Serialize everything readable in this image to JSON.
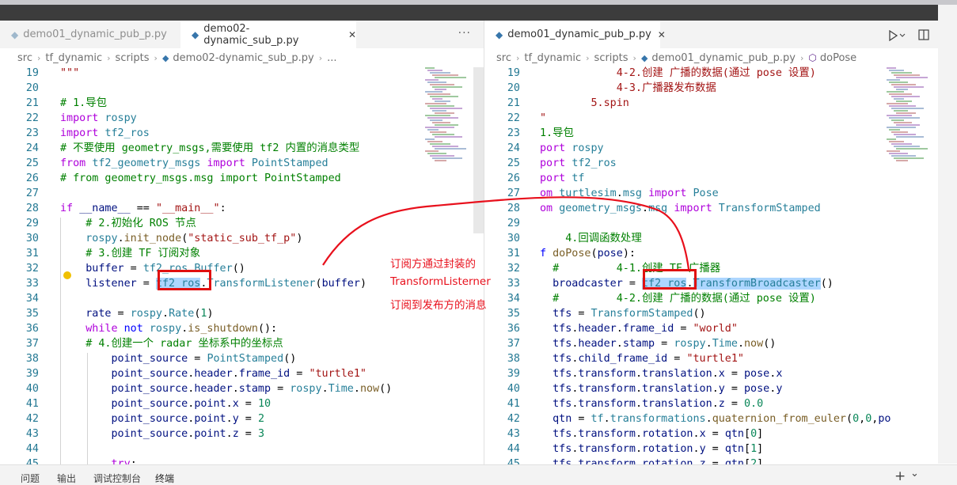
{
  "left_editor": {
    "tabs": [
      {
        "label": "demo01_dynamic_pub_p.py",
        "active": false
      },
      {
        "label": "demo02-dynamic_sub_p.py",
        "active": true
      }
    ],
    "breadcrumb": [
      "src",
      "tf_dynamic",
      "scripts",
      "demo02-dynamic_sub_p.py",
      "..."
    ],
    "lines": [
      {
        "n": "19",
        "html": "<span class='s'>\"\"\"</span>"
      },
      {
        "n": "20",
        "html": ""
      },
      {
        "n": "21",
        "html": "<span class='c'># 1.导包</span>"
      },
      {
        "n": "22",
        "html": "<span class='k'>import</span> <span class='t'>rospy</span>"
      },
      {
        "n": "23",
        "html": "<span class='k'>import</span> <span class='t'>tf2_ros</span>"
      },
      {
        "n": "24",
        "html": "<span class='c'># 不要使用 geometry_msgs,需要使用 tf2 内置的消息类型</span>"
      },
      {
        "n": "25",
        "html": "<span class='k'>from</span> <span class='t'>tf2_geometry_msgs</span> <span class='k'>import</span> <span class='t'>PointStamped</span>"
      },
      {
        "n": "26",
        "html": "<span class='c'># from geometry_msgs.msg import PointStamped</span>"
      },
      {
        "n": "27",
        "html": ""
      },
      {
        "n": "28",
        "html": "<span class='k'>if</span> <span class='v'>__name__</span> == <span class='s'>\"__main__\"</span>:"
      },
      {
        "n": "29",
        "html": "    <span class='c'># 2.初始化 ROS 节点</span>"
      },
      {
        "n": "30",
        "html": "    <span class='t'>rospy</span>.<span class='f'>init_node</span>(<span class='s'>\"static_sub_tf_p\"</span>)"
      },
      {
        "n": "31",
        "html": "    <span class='c'># 3.创建 TF 订阅对象</span>"
      },
      {
        "n": "32",
        "html": "    <span class='v'>buffer</span> = <span class='t'>tf2_ros</span>.<span class='t'>Buffer</span>()"
      },
      {
        "n": "33",
        "html": "    <span class='v'>listener</span> = <span class='t hl'>tf2_ros</span>.<span class='t'>TransformListener</span>(<span class='v'>buffer</span>)"
      },
      {
        "n": "34",
        "html": ""
      },
      {
        "n": "35",
        "html": "    <span class='v'>rate</span> = <span class='t'>rospy</span>.<span class='t'>Rate</span>(<span class='n'>1</span>)"
      },
      {
        "n": "36",
        "html": "    <span class='k'>while</span> <span class='b'>not</span> <span class='t'>rospy</span>.<span class='f'>is_shutdown</span>():"
      },
      {
        "n": "37",
        "html": "    <span class='c'># 4.创建一个 radar 坐标系中的坐标点</span>"
      },
      {
        "n": "38",
        "html": "        <span class='v'>point_source</span> = <span class='t'>PointStamped</span>()"
      },
      {
        "n": "39",
        "html": "        <span class='v'>point_source</span>.<span class='v'>header</span>.<span class='v'>frame_id</span> = <span class='s'>\"turtle1\"</span>"
      },
      {
        "n": "40",
        "html": "        <span class='v'>point_source</span>.<span class='v'>header</span>.<span class='v'>stamp</span> = <span class='t'>rospy</span>.<span class='t'>Time</span>.<span class='f'>now</span>()"
      },
      {
        "n": "41",
        "html": "        <span class='v'>point_source</span>.<span class='v'>point</span>.<span class='v'>x</span> = <span class='n'>10</span>"
      },
      {
        "n": "42",
        "html": "        <span class='v'>point_source</span>.<span class='v'>point</span>.<span class='v'>y</span> = <span class='n'>2</span>"
      },
      {
        "n": "43",
        "html": "        <span class='v'>point_source</span>.<span class='v'>point</span>.<span class='v'>z</span> = <span class='n'>3</span>"
      },
      {
        "n": "44",
        "html": ""
      },
      {
        "n": "45",
        "html": "        <span class='k'>try</span>:"
      }
    ]
  },
  "right_editor": {
    "tabs": [
      {
        "label": "demo01_dynamic_pub_p.py",
        "active": true
      }
    ],
    "breadcrumb": [
      "src",
      "tf_dynamic",
      "scripts",
      "demo01_dynamic_pub_p.py",
      "doPose"
    ],
    "lines": [
      {
        "n": "19",
        "html": "            <span class='s'>4-2.创建 广播的数据(通过 pose 设置)</span>"
      },
      {
        "n": "20",
        "html": "            <span class='s'>4-3.广播器发布数据</span>"
      },
      {
        "n": "21",
        "html": "        <span class='s'>5.spin</span>"
      },
      {
        "n": "22",
        "html": "<span class='s'>\"</span>"
      },
      {
        "n": "23",
        "html": "<span class='c'>1.导包</span>"
      },
      {
        "n": "24",
        "html": "<span class='k'>port</span> <span class='t'>rospy</span>"
      },
      {
        "n": "25",
        "html": "<span class='k'>port</span> <span class='t'>tf2_ros</span>"
      },
      {
        "n": "26",
        "html": "<span class='k'>port</span> <span class='t'>tf</span>"
      },
      {
        "n": "27",
        "html": "<span class='k'>om</span> <span class='t'>turtlesim</span>.<span class='t'>msg</span> <span class='k'>import</span> <span class='t'>Pose</span>"
      },
      {
        "n": "28",
        "html": "<span class='k'>om</span> <span class='t'>geometry_msgs</span>.<span class='t'>msg</span> <span class='k'>import</span> <span class='t'>TransformStamped</span>"
      },
      {
        "n": "29",
        "html": ""
      },
      {
        "n": "30",
        "html": "    <span class='c'>4.回调函数处理</span>"
      },
      {
        "n": "31",
        "html": "<span class='b'>f</span> <span class='f'>doPose</span>(<span class='v'>pose</span>):"
      },
      {
        "n": "32",
        "html": "  <span class='c'>#         4-1.创建 TF 广播器</span>"
      },
      {
        "n": "33",
        "html": "  <span class='v'>broadcaster</span> = <span class='t hl'>tf2_ros</span>.<span class='t hl'>TransformBroadcaster</span>()"
      },
      {
        "n": "34",
        "html": "  <span class='c'>#         4-2.创建 广播的数据(通过 pose 设置)</span>"
      },
      {
        "n": "35",
        "html": "  <span class='v'>tfs</span> = <span class='t'>TransformStamped</span>()"
      },
      {
        "n": "36",
        "html": "  <span class='v'>tfs</span>.<span class='v'>header</span>.<span class='v'>frame_id</span> = <span class='s'>\"world\"</span>"
      },
      {
        "n": "37",
        "html": "  <span class='v'>tfs</span>.<span class='v'>header</span>.<span class='v'>stamp</span> = <span class='t'>rospy</span>.<span class='t'>Time</span>.<span class='f'>now</span>()"
      },
      {
        "n": "38",
        "html": "  <span class='v'>tfs</span>.<span class='v'>child_frame_id</span> = <span class='s'>\"turtle1\"</span>"
      },
      {
        "n": "39",
        "html": "  <span class='v'>tfs</span>.<span class='v'>transform</span>.<span class='v'>translation</span>.<span class='v'>x</span> = <span class='v'>pose</span>.<span class='v'>x</span>"
      },
      {
        "n": "40",
        "html": "  <span class='v'>tfs</span>.<span class='v'>transform</span>.<span class='v'>translation</span>.<span class='v'>y</span> = <span class='v'>pose</span>.<span class='v'>y</span>"
      },
      {
        "n": "41",
        "html": "  <span class='v'>tfs</span>.<span class='v'>transform</span>.<span class='v'>translation</span>.<span class='v'>z</span> = <span class='n'>0.0</span>"
      },
      {
        "n": "42",
        "html": "  <span class='v'>qtn</span> = <span class='t'>tf</span>.<span class='t'>transformations</span>.<span class='f'>quaternion_from_euler</span>(<span class='n'>0</span>,<span class='n'>0</span>,<span class='v'>po</span>"
      },
      {
        "n": "43",
        "html": "  <span class='v'>tfs</span>.<span class='v'>transform</span>.<span class='v'>rotation</span>.<span class='v'>x</span> = <span class='v'>qtn</span>[<span class='n'>0</span>]"
      },
      {
        "n": "44",
        "html": "  <span class='v'>tfs</span>.<span class='v'>transform</span>.<span class='v'>rotation</span>.<span class='v'>y</span> = <span class='v'>qtn</span>[<span class='n'>1</span>]"
      },
      {
        "n": "45",
        "html": "  <span class='v'>tfs</span>.<span class='v'>transform</span>.<span class='v'>rotation</span>.<span class='v'>z</span> = <span class='v'>qtn</span>[<span class='n'>2</span>]"
      }
    ]
  },
  "annotation": {
    "line1": "订阅方通过封装的",
    "line2": "TransformListerner",
    "line3": "订阅到发布方的消息"
  },
  "panel_tabs": [
    "问题",
    "输出",
    "调试控制台",
    "终端"
  ],
  "panel_actions": {
    "add": "+",
    "chevron": "⌄"
  },
  "icons": {
    "python_file": "python-icon",
    "run": "run-icon",
    "split": "split-editor-icon",
    "lightbulb": "lightbulb-icon",
    "more": "more-actions-icon"
  },
  "colors": {
    "annotation_red": "#e8101c",
    "highlight": "#add6ff"
  }
}
